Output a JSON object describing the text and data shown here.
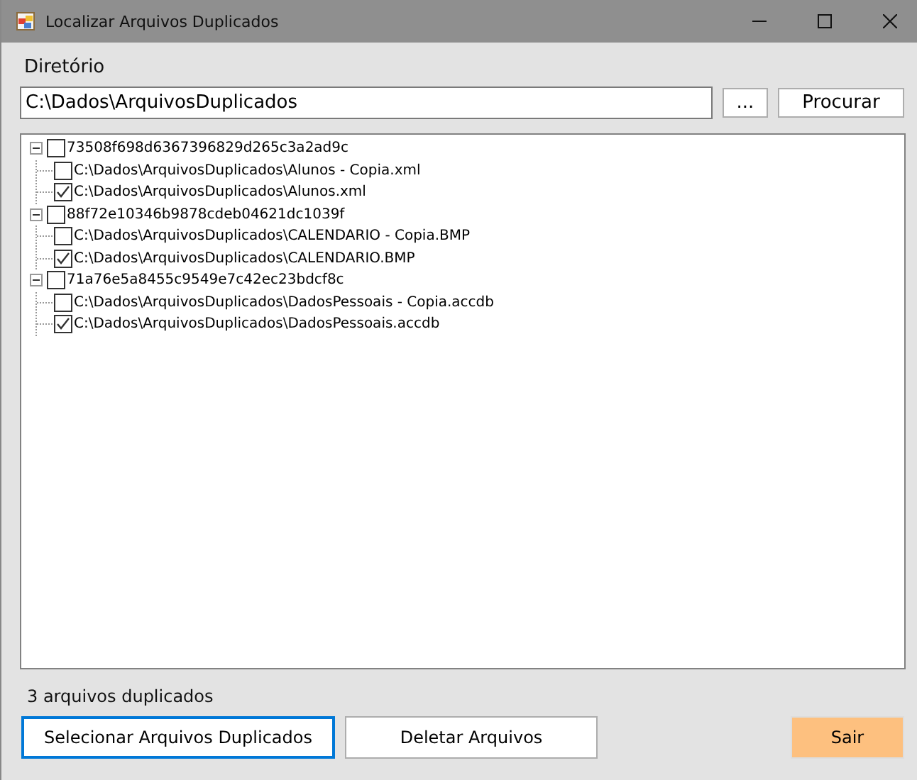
{
  "window": {
    "title": "Localizar Arquivos Duplicados"
  },
  "directory": {
    "label": "Diretório",
    "value": "C:\\Dados\\ArquivosDuplicados",
    "buttons": [
      {
        "label": "...",
        "kind": "browse"
      },
      {
        "label": "Procurar",
        "kind": "search"
      }
    ]
  },
  "tree": [
    {
      "label": "73508f698d6367396829d265c3a2ad9c",
      "checked": false,
      "expanded": true,
      "children": [
        {
          "label": "C:\\Dados\\ArquivosDuplicados\\Alunos - Copia.xml",
          "checked": false
        },
        {
          "label": "C:\\Dados\\ArquivosDuplicados\\Alunos.xml",
          "checked": true
        }
      ]
    },
    {
      "label": "88f72e10346b9878cdeb04621dc1039f",
      "checked": false,
      "expanded": true,
      "children": [
        {
          "label": "C:\\Dados\\ArquivosDuplicados\\CALENDARIO - Copia.BMP",
          "checked": false
        },
        {
          "label": "C:\\Dados\\ArquivosDuplicados\\CALENDARIO.BMP",
          "checked": true
        }
      ]
    },
    {
      "label": "71a76e5a8455c9549e7c42ec23bdcf8c",
      "checked": false,
      "expanded": true,
      "children": [
        {
          "label": "C:\\Dados\\ArquivosDuplicados\\DadosPessoais - Copia.accdb",
          "checked": false
        },
        {
          "label": "C:\\Dados\\ArquivosDuplicados\\DadosPessoais.accdb",
          "checked": true
        }
      ]
    }
  ],
  "status": "3 arquivos duplicados",
  "actions": [
    {
      "label": "Selecionar Arquivos Duplicados",
      "focused": true,
      "color": "#ffffff"
    },
    {
      "label": "Deletar Arquivos",
      "focused": false,
      "color": "#ffffff"
    },
    {
      "label": "Sair",
      "focused": false,
      "color": "#fdc07f"
    }
  ]
}
